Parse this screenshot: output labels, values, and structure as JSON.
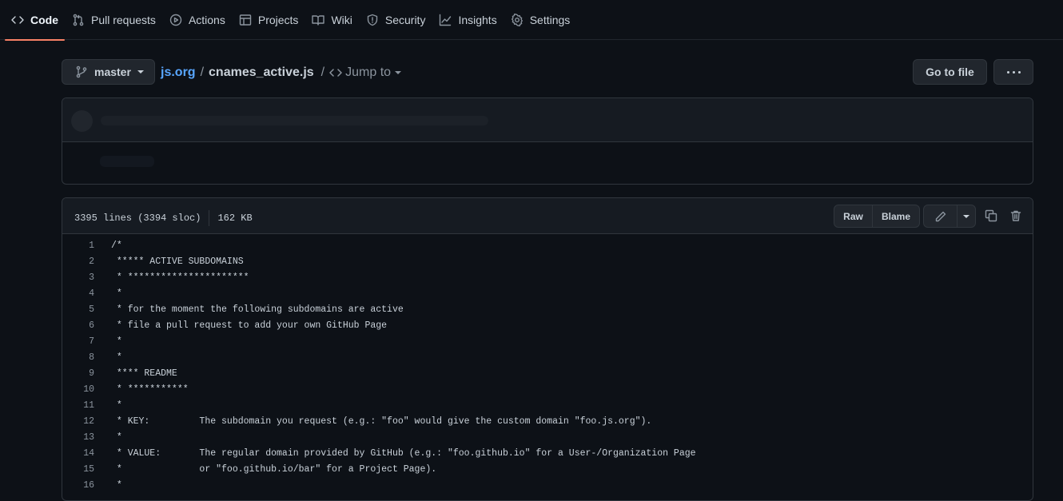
{
  "nav": {
    "tabs": [
      {
        "label": "Code",
        "icon": "code-icon",
        "active": true
      },
      {
        "label": "Pull requests",
        "icon": "pull-request-icon"
      },
      {
        "label": "Actions",
        "icon": "actions-play-icon"
      },
      {
        "label": "Projects",
        "icon": "projects-table-icon"
      },
      {
        "label": "Wiki",
        "icon": "book-icon"
      },
      {
        "label": "Security",
        "icon": "shield-icon"
      },
      {
        "label": "Insights",
        "icon": "graph-icon"
      },
      {
        "label": "Settings",
        "icon": "gear-icon"
      }
    ]
  },
  "breadcrumb": {
    "branch": "master",
    "repo": "js.org",
    "separator": "/",
    "file": "cnames_active.js",
    "jump_label": "Jump to"
  },
  "actions": {
    "go_to_file": "Go to file"
  },
  "file": {
    "lines_info": "3395 lines (3394 sloc)",
    "size": "162 KB",
    "raw_label": "Raw",
    "blame_label": "Blame",
    "lines": [
      {
        "n": "1",
        "text": "/*"
      },
      {
        "n": "2",
        "text": " ***** ACTIVE SUBDOMAINS"
      },
      {
        "n": "3",
        "text": " * **********************"
      },
      {
        "n": "4",
        "text": " *"
      },
      {
        "n": "5",
        "text": " * for the moment the following subdomains are active"
      },
      {
        "n": "6",
        "text": " * file a pull request to add your own GitHub Page"
      },
      {
        "n": "7",
        "text": " *"
      },
      {
        "n": "8",
        "text": " *"
      },
      {
        "n": "9",
        "text": " **** README"
      },
      {
        "n": "10",
        "text": " * ***********"
      },
      {
        "n": "11",
        "text": " *"
      },
      {
        "n": "12",
        "text": " * KEY:         The subdomain you request (e.g.: \"foo\" would give the custom domain \"foo.js.org\")."
      },
      {
        "n": "13",
        "text": " *"
      },
      {
        "n": "14",
        "text": " * VALUE:       The regular domain provided by GitHub (e.g.: \"foo.github.io\" for a User-/Organization Page"
      },
      {
        "n": "15",
        "text": " *              or \"foo.github.io/bar\" for a Project Page)."
      },
      {
        "n": "16",
        "text": " *"
      }
    ]
  },
  "colors": {
    "background": "#0d1117",
    "accent_link": "#58a6ff",
    "active_tab_underline": "#f78166",
    "border": "#30363d"
  }
}
